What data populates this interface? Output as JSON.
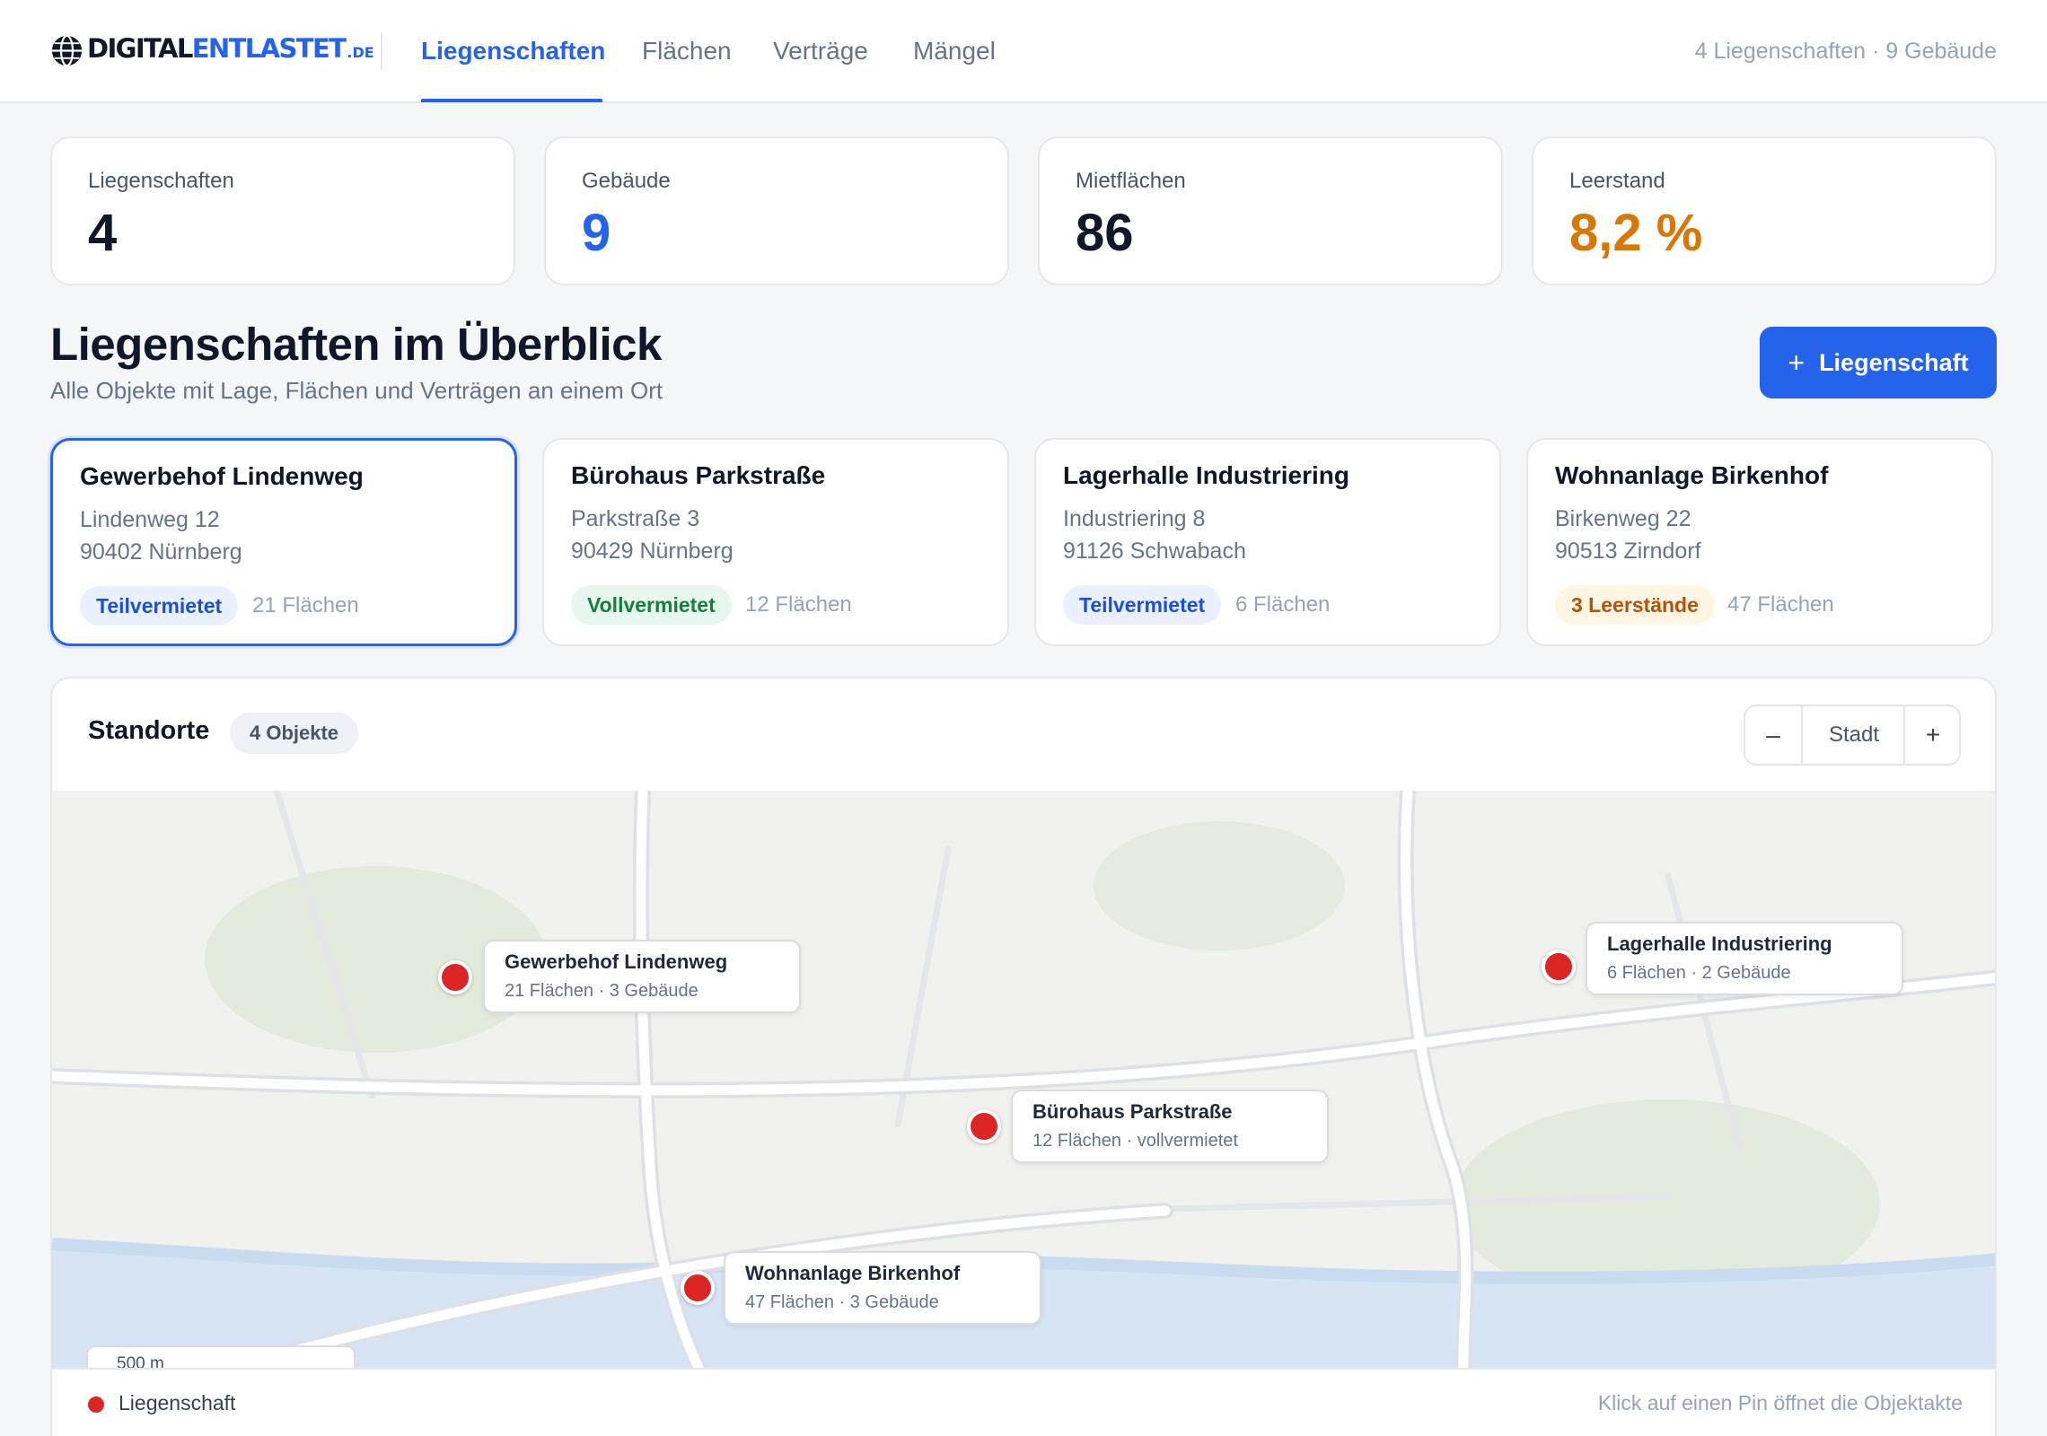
{
  "header": {
    "logo": {
      "part1": "DIGITAL",
      "part2": "ENTLASTET",
      "tld": ".DE"
    },
    "tabs": [
      {
        "label": "Liegenschaften",
        "active": true
      },
      {
        "label": "Flächen",
        "active": false
      },
      {
        "label": "Verträge",
        "active": false
      },
      {
        "label": "Mängel",
        "active": false
      }
    ],
    "summary": "4 Liegenschaften · 9 Gebäude"
  },
  "kpis": [
    {
      "label": "Liegenschaften",
      "value": "4"
    },
    {
      "label": "Gebäude",
      "value": "9"
    },
    {
      "label": "Mietflächen",
      "value": "86"
    },
    {
      "label": "Leerstand",
      "value": "8,2 %"
    }
  ],
  "section": {
    "title": "Liegenschaften im Überblick",
    "subtitle": "Alle Objekte mit Lage, Flächen und Verträgen an einem Ort",
    "add_button": {
      "icon": "plus-icon",
      "label": "Liegenschaft"
    }
  },
  "properties": [
    {
      "name": "Gewerbehof Lindenweg",
      "street": "Lindenweg 12",
      "city": "90402 Nürnberg",
      "status": "Teilvermietet",
      "status_color": "#1d4ed8",
      "count": "21 Flächen",
      "selected": true
    },
    {
      "name": "Bürohaus Parkstraße",
      "street": "Parkstraße 3",
      "city": "90429 Nürnberg",
      "status": "Vollvermietet",
      "status_color": "#15803d",
      "count": "12 Flächen",
      "selected": false
    },
    {
      "name": "Lagerhalle Industriering",
      "street": "Industriering 8",
      "city": "91126 Schwabach",
      "status": "Teilvermietet",
      "status_color": "#1d4ed8",
      "count": "6 Flächen",
      "selected": false
    },
    {
      "name": "Wohnanlage Birkenhof",
      "street": "Birkenweg 22",
      "city": "90513 Zirndorf",
      "status": "3 Leerstände",
      "status_color": "#b45309",
      "count": "47 Flächen",
      "selected": false
    }
  ],
  "map": {
    "title": "Standorte",
    "count_badge": "4 Objekte",
    "zoom": {
      "minus": "–",
      "level": "Stadt",
      "plus": "+"
    },
    "pins": [
      {
        "name": "Gewerbehof Lindenweg",
        "sub": "21 Flächen · 3 Gebäude"
      },
      {
        "name": "Bürohaus Parkstraße",
        "sub": "12 Flächen · vollvermietet"
      },
      {
        "name": "Lagerhalle Industriering",
        "sub": "6 Flächen · 2 Gebäude"
      },
      {
        "name": "Wohnanlage Birkenhof",
        "sub": "47 Flächen · 3 Gebäude"
      }
    ],
    "scale": "500 m",
    "legend": "Liegenschaft",
    "hint": "Klick auf einen Pin öffnet die Objektakte",
    "colors": {
      "pin": "#dc2626",
      "water": "#d6e4f3",
      "park": "#e3ebdc",
      "land": "#f1f2ee"
    }
  },
  "colors": {
    "accent": "#2563eb",
    "warning": "#d97706",
    "success": "#15803d"
  }
}
